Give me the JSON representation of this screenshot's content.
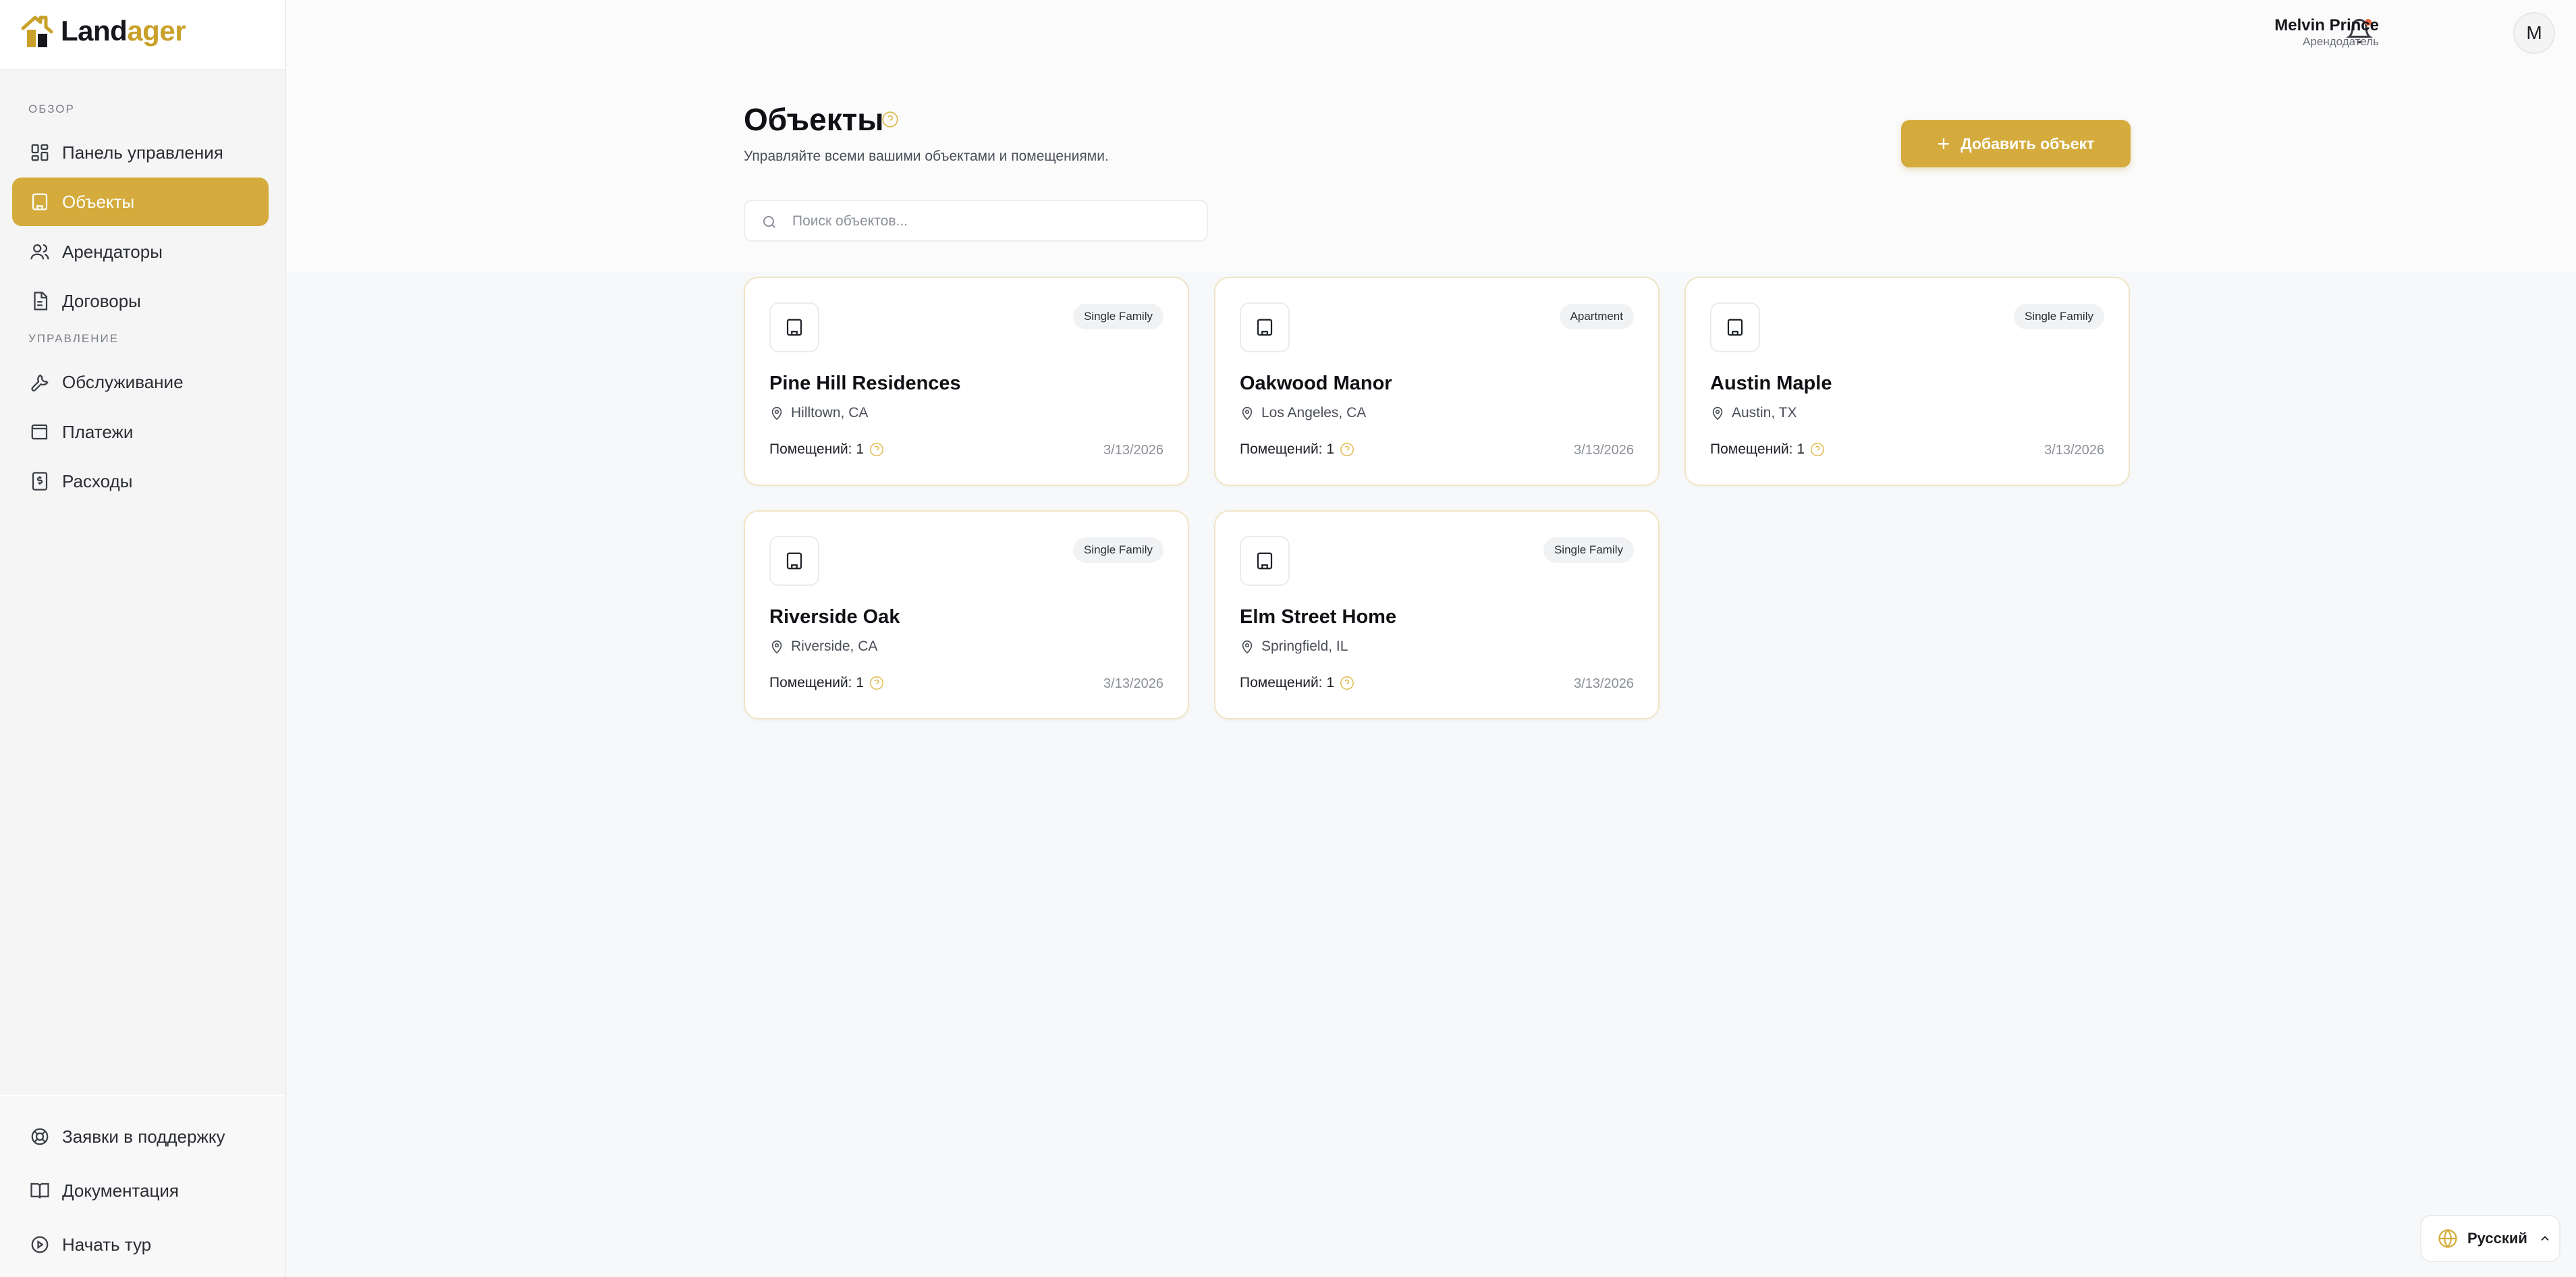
{
  "brand": {
    "name_part1": "Land",
    "name_part2": "ager"
  },
  "sidebar": {
    "section_overview": "ОБЗОР",
    "section_management": "УПРАВЛЕНИЕ",
    "items": [
      {
        "label": "Панель управления",
        "icon": "dashboard-icon"
      },
      {
        "label": "Объекты",
        "icon": "building-icon",
        "active": true
      },
      {
        "label": "Арендаторы",
        "icon": "users-icon"
      },
      {
        "label": "Договоры",
        "icon": "document-icon"
      },
      {
        "label": "Обслуживание",
        "icon": "wrench-icon"
      },
      {
        "label": "Платежи",
        "icon": "wallet-icon"
      },
      {
        "label": "Расходы",
        "icon": "receipt-icon"
      }
    ],
    "bottom_items": [
      {
        "label": "Заявки в поддержку",
        "icon": "lifebuoy-icon"
      },
      {
        "label": "Документация",
        "icon": "book-icon"
      },
      {
        "label": "Начать тур",
        "icon": "play-circle-icon"
      }
    ]
  },
  "topbar": {
    "user_name": "Melvin Prince",
    "user_role": "Арендодатель",
    "avatar_initial": "M"
  },
  "page": {
    "title": "Объекты",
    "subtitle": "Управляйте всеми вашими объектами и помещениями.",
    "add_button_label": "Добавить объект",
    "search_placeholder": "Поиск объектов..."
  },
  "properties": [
    {
      "name": "Pine Hill Residences",
      "type": "Single Family",
      "location": "Hilltown, CA",
      "units_label": "Помещений: 1",
      "date": "3/13/2026"
    },
    {
      "name": "Oakwood Manor",
      "type": "Apartment",
      "location": "Los Angeles, CA",
      "units_label": "Помещений: 1",
      "date": "3/13/2026"
    },
    {
      "name": "Austin Maple",
      "type": "Single Family",
      "location": "Austin, TX",
      "units_label": "Помещений: 1",
      "date": "3/13/2026"
    },
    {
      "name": "Riverside Oak",
      "type": "Single Family",
      "location": "Riverside, CA",
      "units_label": "Помещений: 1",
      "date": "3/13/2026"
    },
    {
      "name": "Elm Street Home",
      "type": "Single Family",
      "location": "Springfield, IL",
      "units_label": "Помещений: 1",
      "date": "3/13/2026"
    }
  ],
  "language": {
    "label": "Русский"
  },
  "colors": {
    "accent": "#d4ab3c",
    "brand_gold": "#c9a12a",
    "notification_dot": "#e8663a"
  }
}
